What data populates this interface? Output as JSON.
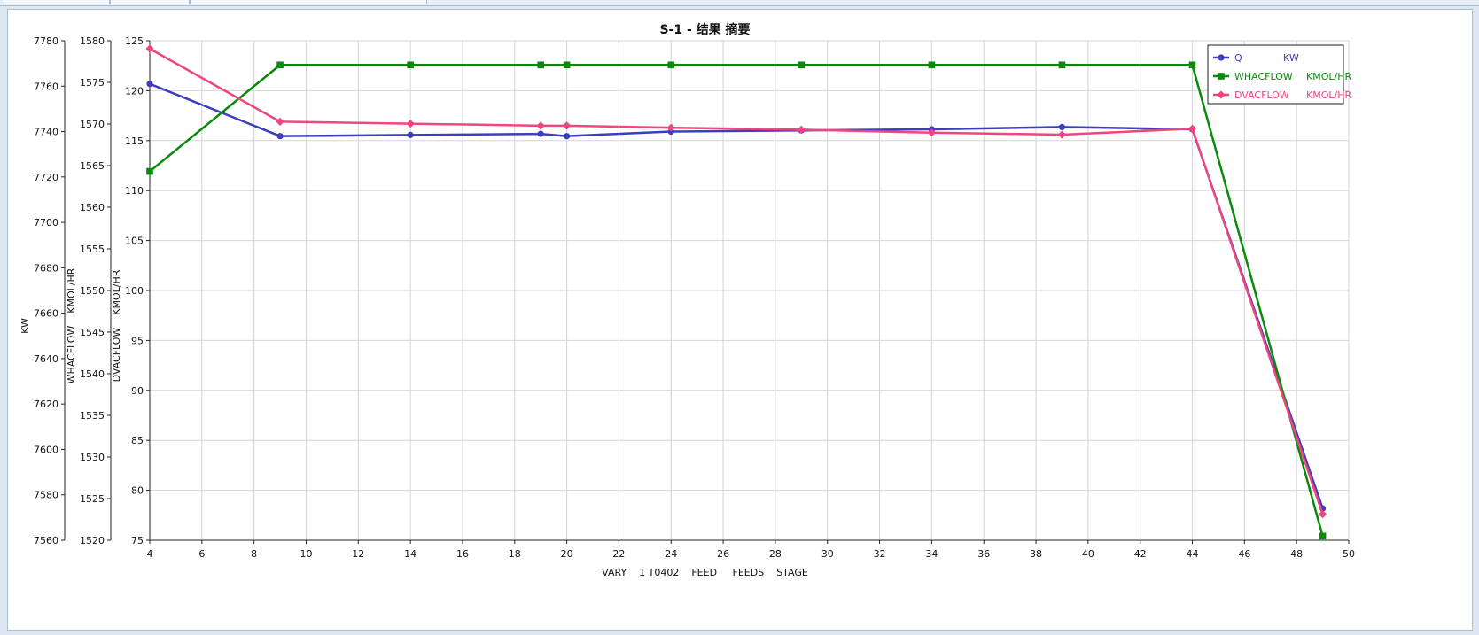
{
  "window": {
    "tabs": [
      "",
      "",
      ""
    ]
  },
  "chart_data": {
    "type": "line",
    "title": "S-1 - 结果 摘要",
    "xlabel": "VARY    1 T0402    FEED     FEEDS    STAGE",
    "xlim": [
      4,
      50
    ],
    "xticks": [
      4,
      6,
      8,
      10,
      12,
      14,
      16,
      18,
      20,
      22,
      24,
      26,
      28,
      30,
      32,
      34,
      36,
      38,
      40,
      42,
      44,
      46,
      48,
      50
    ],
    "grid": true,
    "legend_position": "top-right",
    "axes": [
      {
        "id": "q",
        "label": "KW",
        "lim": [
          7560,
          7780
        ],
        "ticks": [
          7560,
          7580,
          7600,
          7620,
          7640,
          7660,
          7680,
          7700,
          7720,
          7740,
          7760,
          7780
        ]
      },
      {
        "id": "wh",
        "label": "WHACFLOW    KMOL/HR",
        "lim": [
          1520,
          1580
        ],
        "ticks": [
          1520,
          1525,
          1530,
          1535,
          1540,
          1545,
          1550,
          1555,
          1560,
          1565,
          1570,
          1575,
          1580
        ]
      },
      {
        "id": "dv",
        "label": "DVACFLOW    KMOL/HR",
        "lim": [
          75,
          125
        ],
        "ticks": [
          75,
          80,
          85,
          90,
          95,
          100,
          105,
          110,
          115,
          120,
          125
        ]
      }
    ],
    "series": [
      {
        "name": "Q",
        "unit": "KW",
        "axis": "q",
        "color": "#3d3dbf",
        "marker": "circle",
        "x": [
          4,
          9,
          14,
          19,
          20,
          24,
          29,
          34,
          39,
          44,
          49
        ],
        "y": [
          7761,
          7738,
          7738.5,
          7739,
          7738,
          7740,
          7740.5,
          7741,
          7742,
          7741,
          7574
        ]
      },
      {
        "name": "WHACFLOW",
        "unit": "KMOL/HR",
        "axis": "wh",
        "color": "#0a8a0a",
        "marker": "square",
        "x": [
          4,
          9,
          14,
          19,
          20,
          24,
          29,
          34,
          39,
          44,
          49
        ],
        "y": [
          1564.3,
          1577.1,
          1577.1,
          1577.1,
          1577.1,
          1577.1,
          1577.1,
          1577.1,
          1577.1,
          1577.1,
          1520.5
        ]
      },
      {
        "name": "DVACFLOW",
        "unit": "KMOL/HR",
        "axis": "dv",
        "color": "#f0457f",
        "marker": "diamond",
        "x": [
          4,
          9,
          14,
          19,
          20,
          24,
          29,
          34,
          39,
          44,
          49
        ],
        "y": [
          124.2,
          116.9,
          116.7,
          116.5,
          116.5,
          116.3,
          116.1,
          115.8,
          115.6,
          116.2,
          77.6
        ]
      }
    ]
  }
}
